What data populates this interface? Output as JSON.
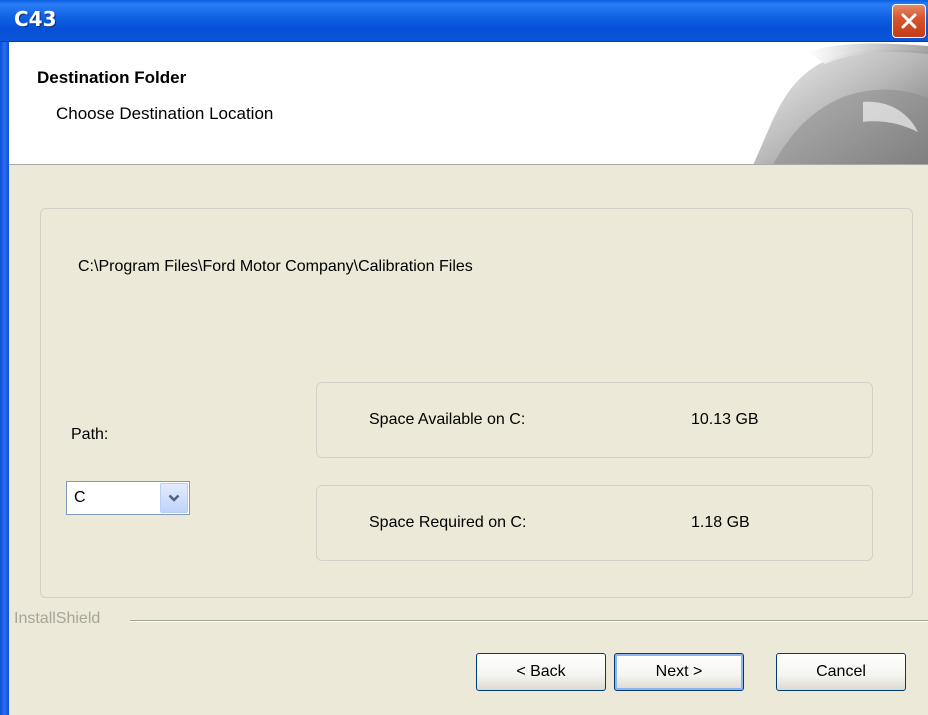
{
  "window": {
    "title": "C43"
  },
  "header": {
    "title": "Destination Folder",
    "subtitle": "Choose Destination Location"
  },
  "destination": {
    "path": "C:\\Program Files\\Ford Motor Company\\Calibration Files"
  },
  "drive": {
    "label": "Path:",
    "selected": "C"
  },
  "space": {
    "available_label": "Space Available on C:",
    "available_value": "10.13 GB",
    "required_label": "Space Required on C:",
    "required_value": "1.18 GB"
  },
  "footer": {
    "brand": "InstallShield"
  },
  "buttons": {
    "back": "< Back",
    "next": "Next >",
    "cancel": "Cancel"
  },
  "icons": {
    "close": "close-icon",
    "dropdown": "chevron-down-icon",
    "header_art": "installer-graphic-icon"
  },
  "colors": {
    "titlebar": "#0a55d6",
    "dialog_bg": "#ece9d8",
    "close_button": "#d8552e"
  }
}
